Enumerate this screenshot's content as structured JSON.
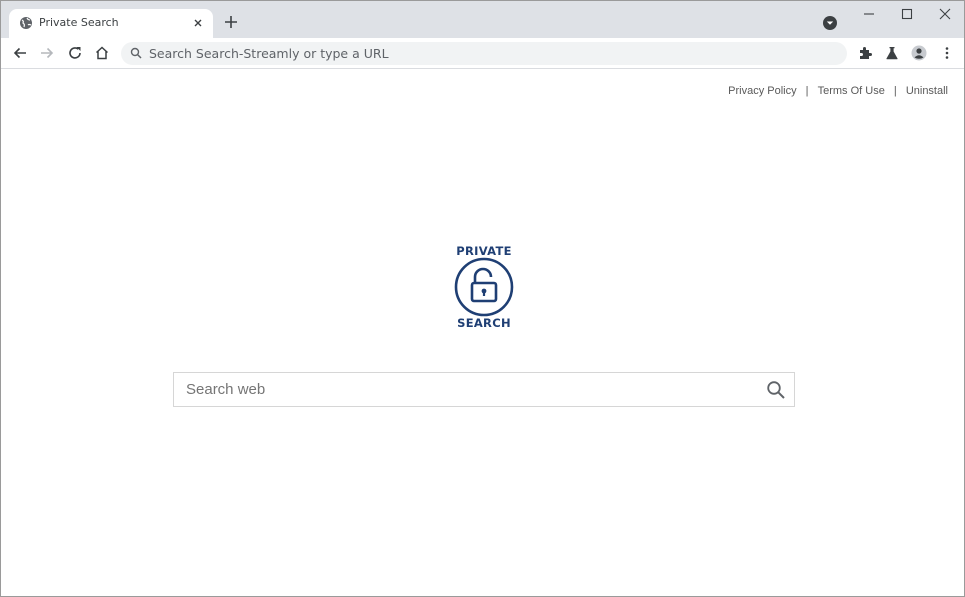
{
  "tab": {
    "title": "Private Search",
    "favicon": "globe-icon"
  },
  "toolbar": {
    "omnibox_placeholder": "Search Search-Streamly or type a URL"
  },
  "page": {
    "links": [
      "Privacy Policy",
      "Terms Of Use",
      "Uninstall"
    ],
    "separator": "|",
    "logo": {
      "top": "PRIVATE",
      "bottom": "SEARCH",
      "icon": "unlocked-padlock-icon"
    },
    "search": {
      "placeholder": "Search web",
      "button_icon": "search-icon"
    }
  },
  "colors": {
    "tabstrip": "#dee1e6",
    "logo": "#1f3f74",
    "link": "#595959"
  }
}
